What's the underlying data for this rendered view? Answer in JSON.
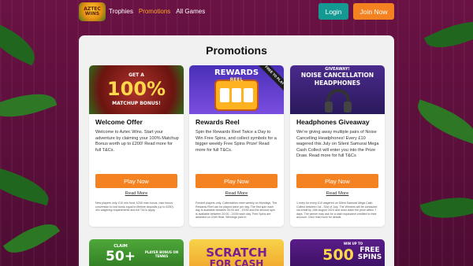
{
  "nav": {
    "logo_text": "AZTEC WINS",
    "links": [
      {
        "label": "Trophies",
        "active": false
      },
      {
        "label": "Promotions",
        "active": true
      },
      {
        "label": "All Games",
        "active": false
      }
    ],
    "login_label": "Login",
    "join_label": "Join Now"
  },
  "page": {
    "title": "Promotions"
  },
  "colors": {
    "accent_orange": "#f58220",
    "login_teal": "#159a93",
    "active_link": "#ffa726"
  },
  "cards": [
    {
      "banner_line1": "GET A",
      "banner_line2": "100%",
      "banner_line3": "MATCHUP BONUS!",
      "title": "Welcome Offer",
      "desc": "Welcome to Aztec Wins. Start your adventure by claiming your 100% Matchup Bonus worth up to £200! Read more for full T&Cs.",
      "button": "Play Now",
      "more": "Read More",
      "terms": "New players only. £10 min fund, £200 max bonus, max bonus conversion to lost funds equal to lifetime deposits (up to £250). 40x wagering requirements and full T&Cs apply."
    },
    {
      "banner_line1": "REWARDS",
      "banner_line2": "REEL",
      "banner_ribbon": "FREE TO PLAY",
      "title": "Rewards Reel",
      "desc": "Spin the Rewards Reel Twice a Day to Win Free Spins, and collect symbols for a bigger weekly Free Spins Prize! Read more for full T&Cs.",
      "button": "Play Now",
      "more": "Read More",
      "terms": "Funded players only. Collectables reset weekly on Mondays. The Rewards Reel can be played twice per day. The first spin each day is available between 00:00 AM - 19:59 and the second spin is available between 20:00 - 23:59 each day. Free Spins are awarded on Chilli Heat. Winnings paid in"
    },
    {
      "banner_line1": "GIVEAWAY!",
      "banner_line2": "NOISE CANCELLATION",
      "banner_line3": "HEADPHONES",
      "title": "Headphones Giveaway",
      "desc": "We're giving away multiple pairs of Noise Cancelling Headphones! Every £10 wagered this July on Silent Samurai Mega Cash Collect will enter you into the Prize Draw. Read more for full T&Cs",
      "button": "Play Now",
      "more": "Read More",
      "terms": "1 entry for every £10 wagered on Silent Samurai Mega Cash Collect between 1st - 31st of July. The Winners will be contacted via email by 10th August 2024 and must claim the prize within 7 days. The winner may ask for a cash equivalent credited to their account. Click read more for details."
    }
  ],
  "bottom_cards": [
    {
      "line1": "CLAIM",
      "line2": "50+",
      "line3": "PLAYER BONUS ON TENNIS"
    },
    {
      "line1": "SCRATCH",
      "line2": "FOR CASH"
    },
    {
      "line1": "WIN UP TO",
      "line2": "500",
      "line3": "FREE SPINS"
    }
  ]
}
